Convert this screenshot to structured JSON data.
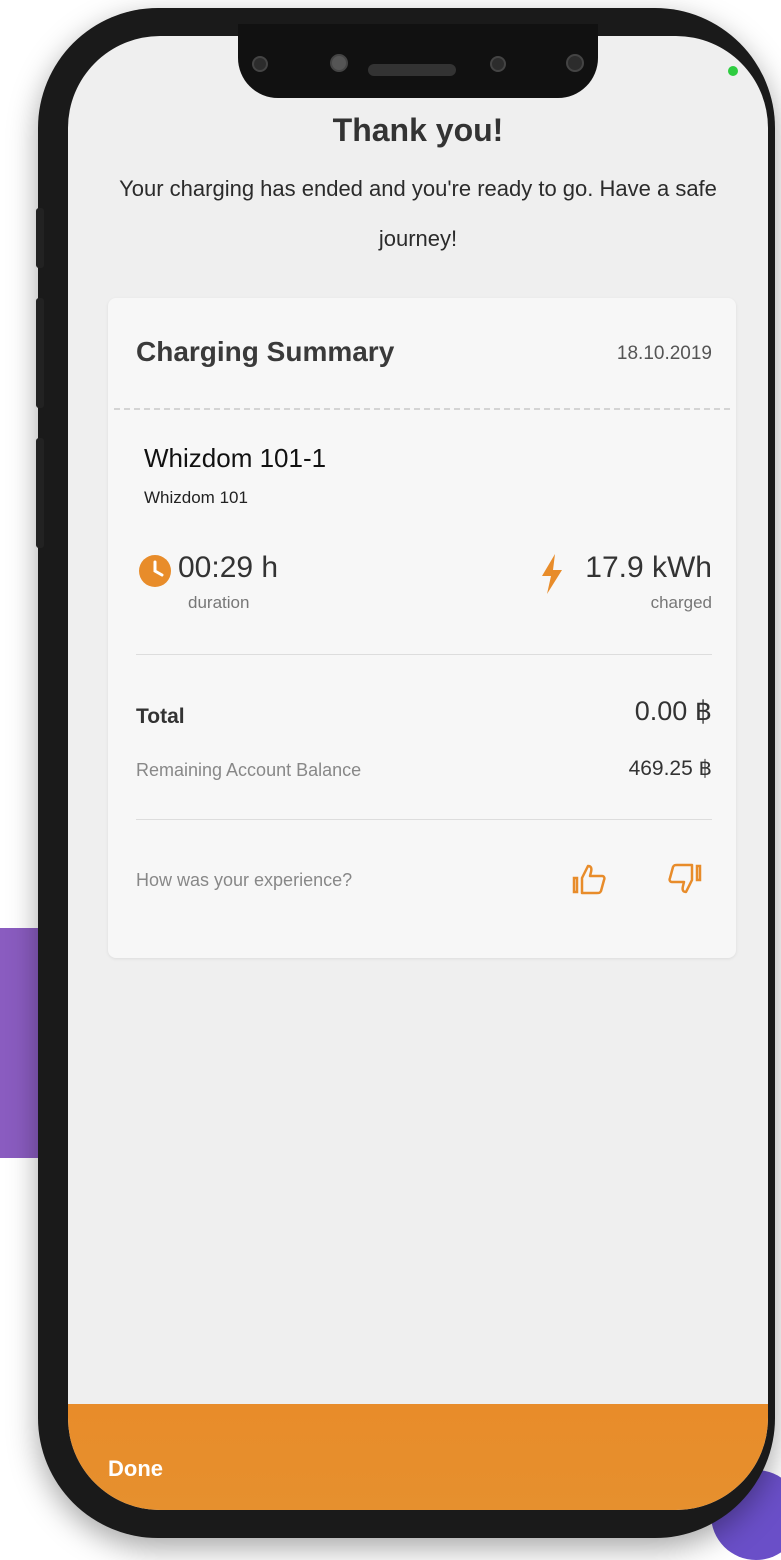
{
  "header": {
    "title": "Thank you!",
    "message_line1": "Your charging has ended and you're ready to go. Have a safe",
    "message_line2": "journey!"
  },
  "summary": {
    "title": "Charging Summary",
    "date": "18.10.2019",
    "station_name": "Whizdom 101-1",
    "station_location": "Whizdom 101",
    "duration_value": "00:29 h",
    "duration_label": "duration",
    "energy_value": "17.9 kWh",
    "energy_label": "charged",
    "total_label": "Total",
    "total_value": "0.00 ฿",
    "balance_label": "Remaining Account Balance",
    "balance_value": "469.25 ฿",
    "experience_question": "How was your experience?"
  },
  "footer": {
    "done_label": "Done"
  },
  "colors": {
    "accent": "#e88c2a",
    "screen_bg": "#efefef",
    "card_bg": "#f7f7f7",
    "purple_decoration": "#8a5cc0"
  },
  "icons": {
    "duration": "clock-icon",
    "energy": "lightning-bolt-icon",
    "like": "thumbs-up-icon",
    "dislike": "thumbs-down-icon"
  }
}
